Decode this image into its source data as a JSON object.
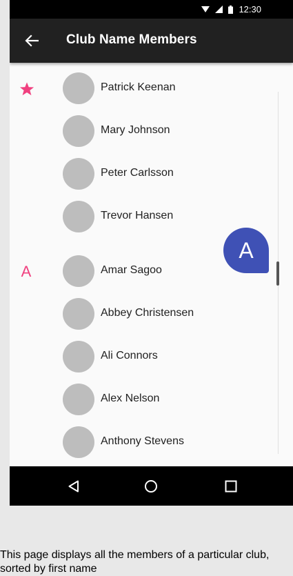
{
  "status_bar": {
    "time": "12:30"
  },
  "app_bar": {
    "title": "Club Name Members"
  },
  "sections": [
    {
      "index_label": "★"
    },
    {
      "index_label": "A"
    }
  ],
  "members": [
    {
      "name": "Patrick Keenan"
    },
    {
      "name": "Mary Johnson"
    },
    {
      "name": "Peter Carlsson"
    },
    {
      "name": "Trevor Hansen"
    },
    {
      "name": "Amar Sagoo"
    },
    {
      "name": "Abbey Christensen"
    },
    {
      "name": "Ali Connors"
    },
    {
      "name": "Alex Nelson"
    },
    {
      "name": "Anthony Stevens"
    }
  ],
  "fast_scroll": {
    "letter": "A",
    "color": "#3f51b5"
  },
  "accent_color": "#f0407f",
  "caption": "This page displays all the members of a particular club, sorted by first name"
}
